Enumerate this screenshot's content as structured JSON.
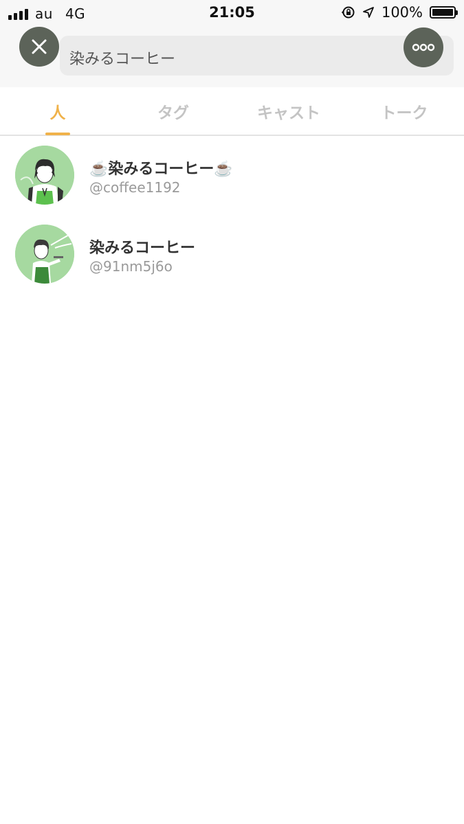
{
  "status_bar": {
    "carrier": "au",
    "network": "4G",
    "time": "21:05",
    "battery_percent": "100%"
  },
  "search": {
    "query": "染みるコーヒー"
  },
  "tabs": [
    {
      "label": "人",
      "active": true
    },
    {
      "label": "タグ",
      "active": false
    },
    {
      "label": "キャスト",
      "active": false
    },
    {
      "label": "トーク",
      "active": false
    }
  ],
  "results": [
    {
      "name": "☕️染みるコーヒー☕️",
      "handle": "@coffee1192"
    },
    {
      "name": "染みるコーヒー",
      "handle": "@91nm5j6o"
    }
  ],
  "colors": {
    "accent": "#f0b24a",
    "button_bg": "#5c6359",
    "avatar_bg": "#a6d9a0",
    "tab_inactive": "#c4c4c4"
  }
}
